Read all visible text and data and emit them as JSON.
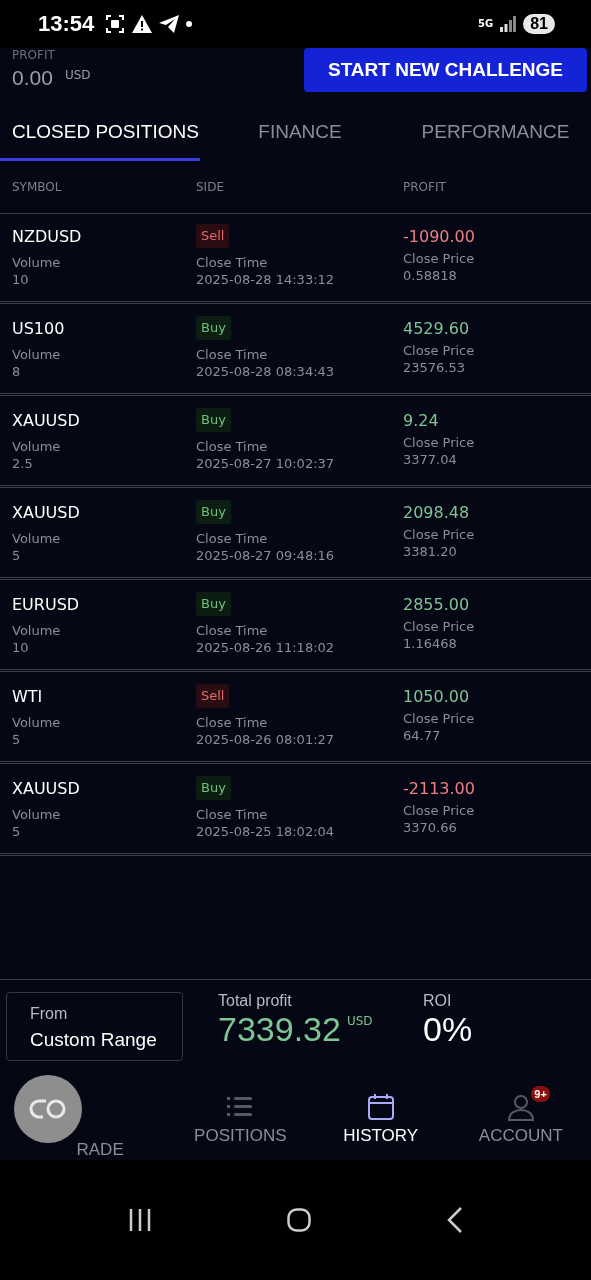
{
  "status_bar": {
    "time": "13:54",
    "network": "5G",
    "battery": "81"
  },
  "header": {
    "profit_label": "PROFIT",
    "profit_value": "0.00",
    "currency": "USD",
    "button": "START NEW CHALLENGE"
  },
  "tabs": [
    {
      "label": "CLOSED POSITIONS",
      "selected": true
    },
    {
      "label": "FINANCE",
      "selected": false
    },
    {
      "label": "PERFORMANCE",
      "selected": false
    }
  ],
  "table": {
    "columns": [
      "SYMBOL",
      "SIDE",
      "PROFIT"
    ],
    "rows": [
      {
        "symbol": "NZDUSD",
        "volume_label": "Volume",
        "volume": "10",
        "side": "Sell",
        "kind": "sell",
        "time_label": "Close Time",
        "close_time": "2025-08-28 14:33:12",
        "profit": "-1090.00",
        "loss": true,
        "price_label": "Close Price",
        "close_price": "0.58818"
      },
      {
        "symbol": "US100",
        "volume_label": "Volume",
        "volume": "8",
        "side": "Buy",
        "kind": "buy",
        "time_label": "Close Time",
        "close_time": "2025-08-28 08:34:43",
        "profit": "4529.60",
        "loss": false,
        "price_label": "Close Price",
        "close_price": "23576.53"
      },
      {
        "symbol": "XAUUSD",
        "volume_label": "Volume",
        "volume": "2.5",
        "side": "Buy",
        "kind": "buy",
        "time_label": "Close Time",
        "close_time": "2025-08-27 10:02:37",
        "profit": "9.24",
        "loss": false,
        "price_label": "Close Price",
        "close_price": "3377.04"
      },
      {
        "symbol": "XAUUSD",
        "volume_label": "Volume",
        "volume": "5",
        "side": "Buy",
        "kind": "buy",
        "time_label": "Close Time",
        "close_time": "2025-08-27 09:48:16",
        "profit": "2098.48",
        "loss": false,
        "price_label": "Close Price",
        "close_price": "3381.20"
      },
      {
        "symbol": "EURUSD",
        "volume_label": "Volume",
        "volume": "10",
        "side": "Buy",
        "kind": "buy",
        "time_label": "Close Time",
        "close_time": "2025-08-26 11:18:02",
        "profit": "2855.00",
        "loss": false,
        "price_label": "Close Price",
        "close_price": "1.16468"
      },
      {
        "symbol": "WTI",
        "volume_label": "Volume",
        "volume": "5",
        "side": "Sell",
        "kind": "sell",
        "time_label": "Close Time",
        "close_time": "2025-08-26 08:01:27",
        "profit": "1050.00",
        "loss": false,
        "price_label": "Close Price",
        "close_price": "64.77"
      },
      {
        "symbol": "XAUUSD",
        "volume_label": "Volume",
        "volume": "5",
        "side": "Buy",
        "kind": "buy",
        "time_label": "Close Time",
        "close_time": "2025-08-25 18:02:04",
        "profit": "-2113.00",
        "loss": true,
        "price_label": "Close Price",
        "close_price": "3370.66"
      }
    ]
  },
  "summary": {
    "range_label": "From",
    "range_value": "Custom Range",
    "total_label": "Total profit",
    "total_value": "7339.32",
    "total_currency": "USD",
    "roi_label": "ROI",
    "roi_value": "0%"
  },
  "bottom_nav": [
    {
      "label": "RADE",
      "selected": false
    },
    {
      "label": "POSITIONS",
      "selected": false
    },
    {
      "label": "HISTORY",
      "selected": true
    },
    {
      "label": "ACCOUNT",
      "selected": false,
      "badge": "9+"
    }
  ]
}
